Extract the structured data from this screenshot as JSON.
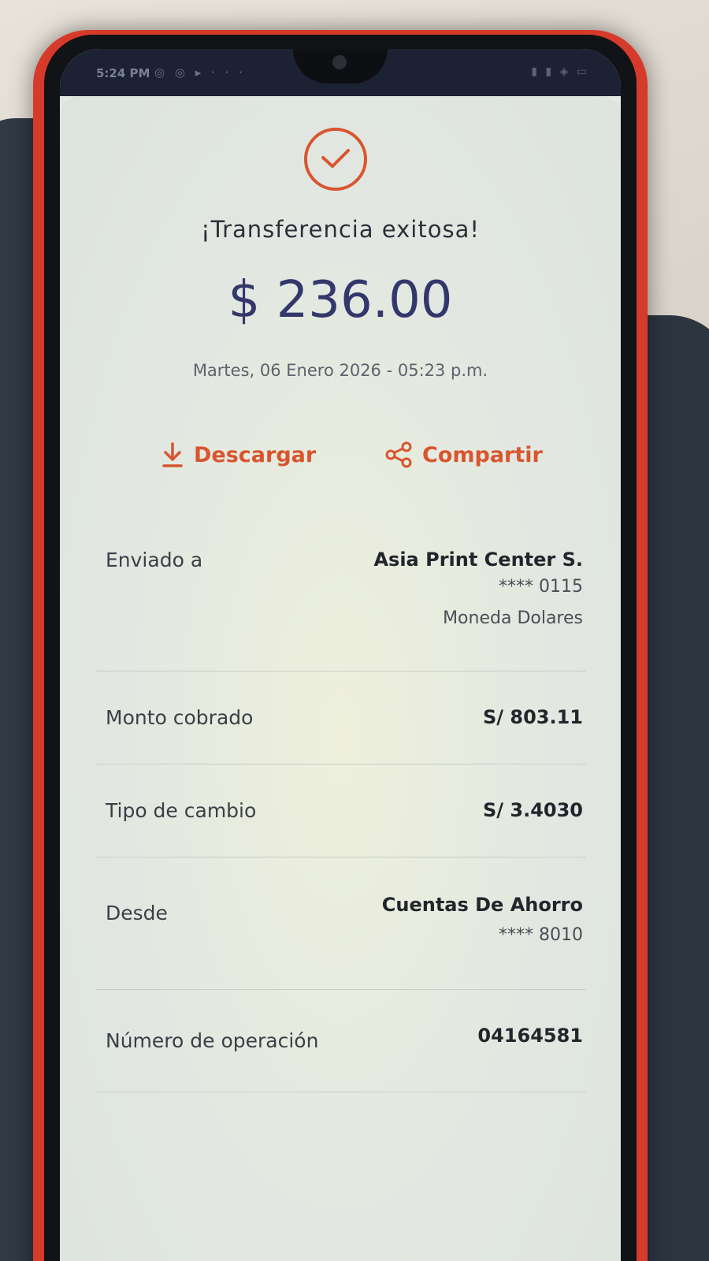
{
  "status_bar": {
    "time": "5:24 PM",
    "notifications": "◎ ◎ ▸ · · ·",
    "system": "▮ ▮ ◈ ▭"
  },
  "receipt": {
    "success_icon": "checkmark-circle-icon",
    "title": "¡Transferencia exitosa!",
    "amount": "$ 236.00",
    "datetime": "Martes, 06 Enero 2026 - 05:23 p.m."
  },
  "actions": {
    "download_label": "Descargar",
    "download_icon": "download-icon",
    "share_label": "Compartir",
    "share_icon": "share-icon"
  },
  "details": {
    "sent_to": {
      "label": "Enviado a",
      "name": "Asia Print Center S.",
      "account": "**** 0115",
      "currency": "Moneda Dolares"
    },
    "amount_charged": {
      "label": "Monto cobrado",
      "value": "S/ 803.11"
    },
    "exchange_rate": {
      "label": "Tipo de cambio",
      "value": "S/ 3.4030"
    },
    "from": {
      "label": "Desde",
      "account_name": "Cuentas De Ahorro",
      "account": "**** 8010"
    },
    "operation_number": {
      "label": "Número de operación",
      "value": "04164581"
    }
  },
  "colors": {
    "accent": "#d8552e",
    "amount": "#33376b",
    "phone_frame": "#d63a2a"
  }
}
